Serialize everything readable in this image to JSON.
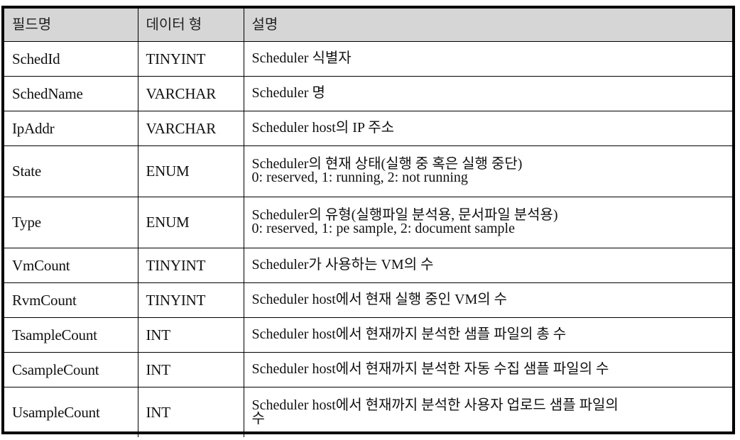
{
  "table": {
    "headers": {
      "field": "필드명",
      "type": "데이터 형",
      "description": "설명"
    },
    "header_bg": "#d6d6d6",
    "rows": [
      {
        "field": "SchedId",
        "type": "TINYINT",
        "description": [
          "Scheduler 식별자"
        ]
      },
      {
        "field": "SchedName",
        "type": "VARCHAR",
        "description": [
          "Scheduler 명"
        ]
      },
      {
        "field": "IpAddr",
        "type": "VARCHAR",
        "description": [
          "Scheduler host의 IP 주소"
        ]
      },
      {
        "field": "State",
        "type": "ENUM",
        "description": [
          "Scheduler의 현재 상태(실행 중 혹은 실행 중단)",
          "0: reserved, 1: running, 2: not running"
        ]
      },
      {
        "field": "Type",
        "type": "ENUM",
        "description": [
          "Scheduler의 유형(실행파일 분석용, 문서파일 분석용)",
          "0: reserved, 1: pe sample, 2: document sample"
        ]
      },
      {
        "field": "VmCount",
        "type": "TINYINT",
        "description": [
          "Scheduler가 사용하는 VM의 수"
        ]
      },
      {
        "field": "RvmCount",
        "type": "TINYINT",
        "description": [
          "Scheduler host에서 현재 실행 중인 VM의 수"
        ]
      },
      {
        "field": "TsampleCount",
        "type": "INT",
        "description": [
          "Scheduler host에서 현재까지 분석한 샘플 파일의 총 수"
        ]
      },
      {
        "field": "CsampleCount",
        "type": "INT",
        "description": [
          "Scheduler host에서 현재까지 분석한 자동 수집 샘플 파일의 수"
        ]
      },
      {
        "field": "UsampleCount",
        "type": "INT",
        "description": [
          "Scheduler host에서 현재까지 분석한 사용자 업로드 샘플 파일의",
          "수"
        ]
      }
    ]
  }
}
